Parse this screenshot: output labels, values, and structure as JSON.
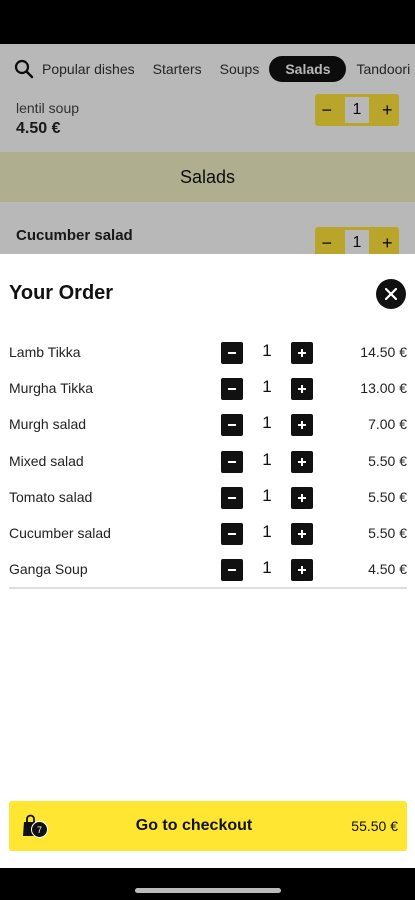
{
  "nav": {
    "tabs": [
      "Popular dishes",
      "Starters",
      "Soups",
      "Salads",
      "Tandoori"
    ],
    "active_tab": "Salads"
  },
  "background": {
    "item1": {
      "name": "lentil soup",
      "price": "4.50 €",
      "qty": "1"
    },
    "section_title": "Salads",
    "item2": {
      "name": "Cucumber salad",
      "qty": "1"
    },
    "stepper_minus": "−",
    "stepper_plus": "+"
  },
  "order": {
    "title": "Your Order",
    "items": [
      {
        "name": "Lamb Tikka",
        "qty": "1",
        "price": "14.50 €"
      },
      {
        "name": "Murgha Tikka",
        "qty": "1",
        "price": "13.00 €"
      },
      {
        "name": "Murgh salad",
        "qty": "1",
        "price": "7.00 €"
      },
      {
        "name": "Mixed salad",
        "qty": "1",
        "price": "5.50 €"
      },
      {
        "name": "Tomato salad",
        "qty": "1",
        "price": "5.50 €"
      },
      {
        "name": "Cucumber salad",
        "qty": "1",
        "price": "5.50 €"
      },
      {
        "name": "Ganga Soup",
        "qty": "1",
        "price": "4.50 €"
      }
    ]
  },
  "checkout": {
    "label": "Go to checkout",
    "total": "55.50 €",
    "badge_count": "7"
  },
  "colors": {
    "accent": "#ffe632",
    "dark": "#111111"
  },
  "icons": [
    "search-icon",
    "close-icon",
    "minus-icon",
    "plus-icon",
    "shopping-bag-icon"
  ]
}
